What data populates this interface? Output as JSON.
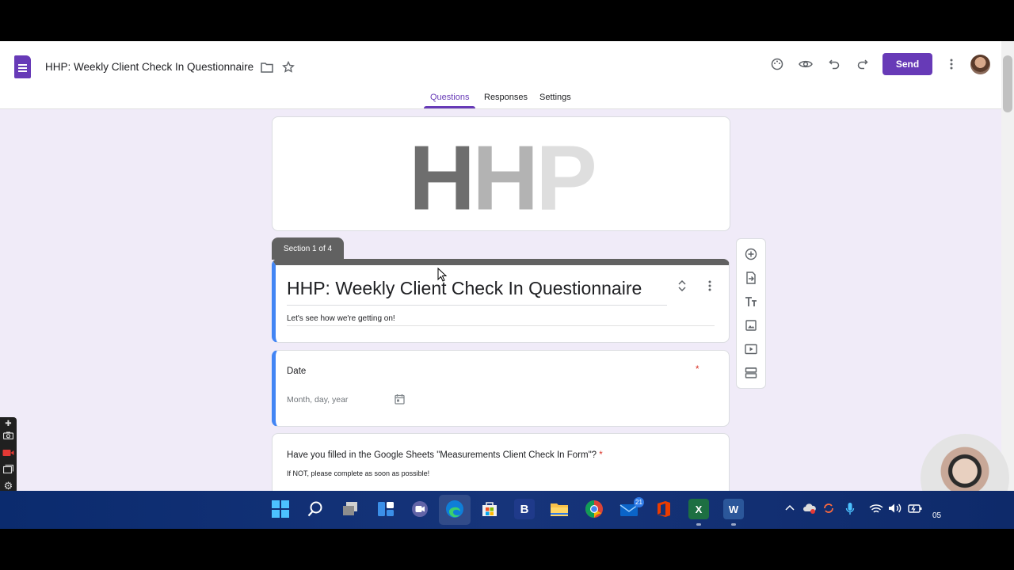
{
  "app": {
    "doc_title": "HHP: Weekly Client Check In Questionnaire",
    "send_label": "Send",
    "colors": {
      "brand": "#673ab7",
      "accent_blue": "#4285f4",
      "section_gray": "#616161"
    }
  },
  "tabs": [
    {
      "label": "Questions",
      "active": true
    },
    {
      "label": "Responses",
      "active": false
    },
    {
      "label": "Settings",
      "active": false
    }
  ],
  "header_image": {
    "text": "HHP"
  },
  "section": {
    "badge": "Section 1 of 4",
    "title": "HHP: Weekly Client Check In Questionnaire",
    "description": "Let's see how we're getting on!"
  },
  "questions": [
    {
      "title": "Date",
      "required": true,
      "placeholder": "Month, day, year",
      "icon": "calendar-icon"
    },
    {
      "title": "Have you filled in the Google Sheets \"Measurements Client Check In Form\"?",
      "required": true,
      "help": "If NOT, please complete as soon as possible!"
    }
  ],
  "required_mark": "*",
  "side_toolbar": [
    "add-question-icon",
    "import-questions-icon",
    "add-title-icon",
    "add-image-icon",
    "add-video-icon",
    "add-section-icon"
  ],
  "taskbar": {
    "mail_badge": "21",
    "icons": [
      "windows-start-icon",
      "search-icon",
      "task-view-icon",
      "widgets-icon",
      "teams-chat-icon",
      "edge-icon",
      "store-icon",
      "b-app-icon",
      "file-explorer-icon",
      "chrome-icon",
      "mail-icon",
      "office-icon",
      "excel-icon",
      "word-icon"
    ],
    "b_label": "B",
    "excel_label": "X",
    "word_label": "W",
    "clock_fragment": "05"
  }
}
